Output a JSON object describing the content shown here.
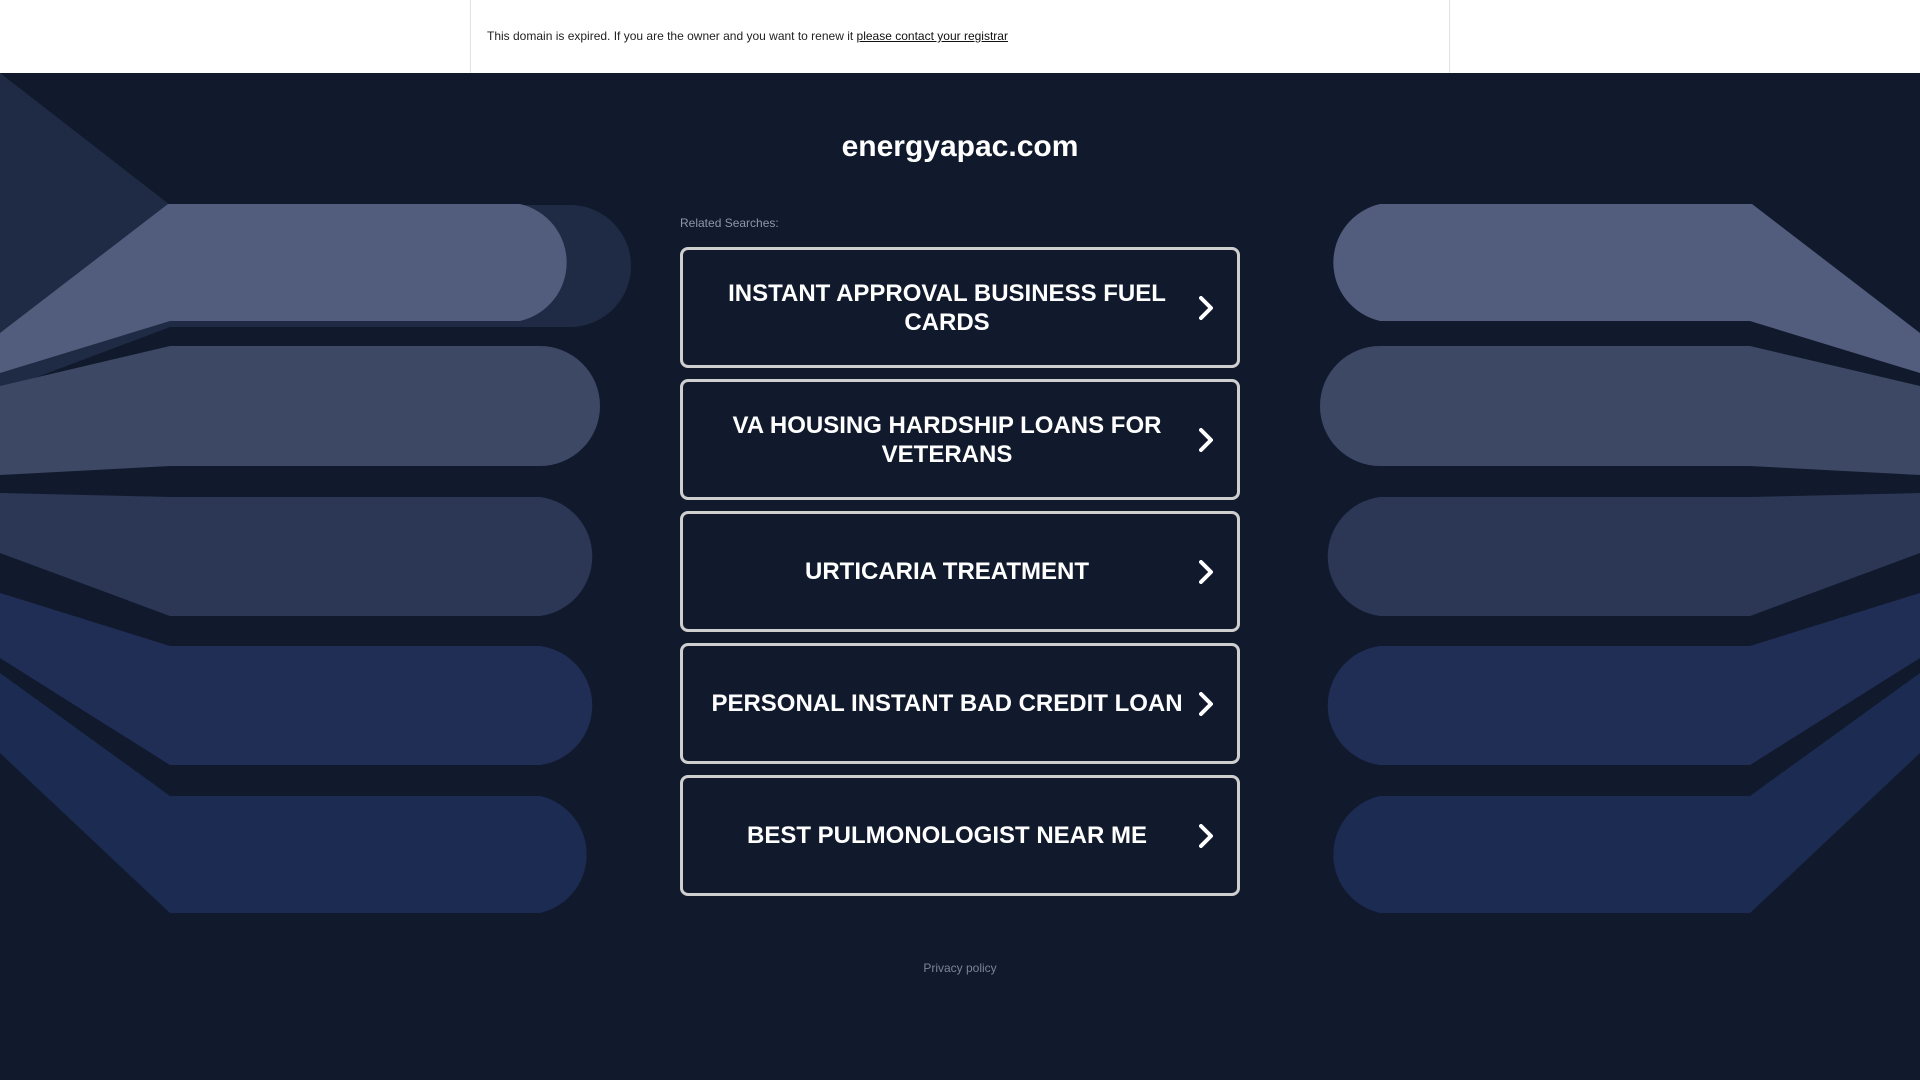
{
  "notice": {
    "text": "This domain is expired. If you are the owner and you want to renew it",
    "link": "please contact your registrar"
  },
  "domain": "energyapac.com",
  "related_label": "Related Searches:",
  "searches": [
    {
      "label": "INSTANT APPROVAL BUSINESS FUEL CARDS"
    },
    {
      "label": "VA HOUSING HARDSHIP LOANS FOR VETERANS"
    },
    {
      "label": "URTICARIA TREATMENT"
    },
    {
      "label": "PERSONAL INSTANT BAD CREDIT LOAN"
    },
    {
      "label": "BEST PULMONOLOGIST NEAR ME"
    }
  ],
  "icons": {
    "chevron": "chevron-right-icon"
  },
  "footer": {
    "privacy": "Privacy policy"
  },
  "colors": {
    "background": "#111a2d",
    "button_border": "#cfcfcf",
    "text": "#ffffff"
  }
}
